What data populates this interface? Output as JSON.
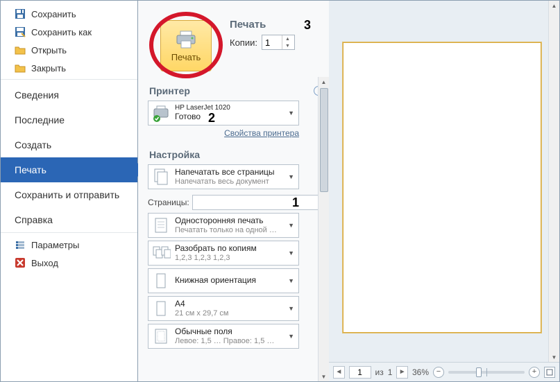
{
  "sidebar": {
    "save": "Сохранить",
    "save_as": "Сохранить как",
    "open": "Открыть",
    "close": "Закрыть",
    "info": "Сведения",
    "recent": "Последние",
    "new": "Создать",
    "print": "Печать",
    "save_send": "Сохранить и отправить",
    "help": "Справка",
    "options": "Параметры",
    "exit": "Выход"
  },
  "print": {
    "header": "Печать",
    "button_label": "Печать",
    "copies_label": "Копии:",
    "copies_value": "1",
    "printer_header": "Принтер",
    "printer_name": "HP LaserJet 1020",
    "printer_status": "Готово",
    "printer_props": "Свойства принтера",
    "settings_header": "Настройка",
    "opt_all_pages_t": "Напечатать все страницы",
    "opt_all_pages_s": "Напечатать весь документ",
    "pages_label": "Страницы:",
    "pages_value": "",
    "opt_oneside_t": "Односторонняя печать",
    "opt_oneside_s": "Печатать только на одной …",
    "opt_collate_t": "Разобрать по копиям",
    "opt_collate_s": "1,2,3   1,2,3   1,2,3",
    "opt_orient_t": "Книжная ориентация",
    "opt_a4_t": "A4",
    "opt_a4_s": "21 см x 29,7 см",
    "opt_margins_t": "Обычные поля",
    "opt_margins_s": "Левое: 1,5 …   Правое: 1,5 …"
  },
  "preview": {
    "page_current": "1",
    "page_of_label": "из",
    "page_total": "1",
    "zoom_pct": "36%"
  },
  "annot": {
    "a1": "1",
    "a2": "2",
    "a3": "3"
  }
}
